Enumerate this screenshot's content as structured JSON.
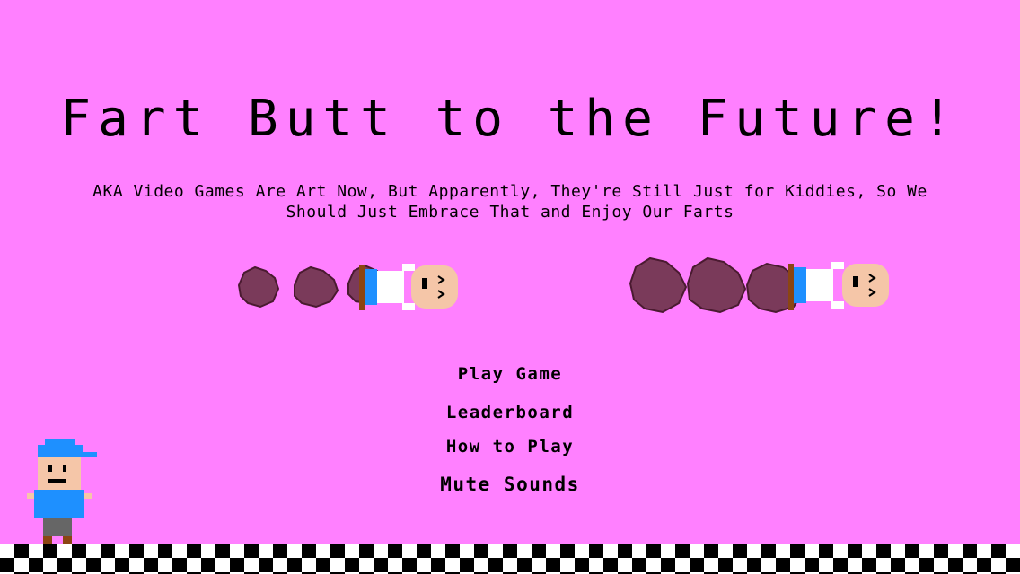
{
  "game": {
    "title": "Fart Butt to the Future!",
    "subtitle": "AKA Video Games Are Art Now, But Apparently, They're Still Just for Kiddies, So We Should Just Embrace That and Enjoy Our Farts"
  },
  "menu": {
    "play": "Play Game",
    "leaderboard": "Leaderboard",
    "how_to_play": "How to Play",
    "mute": "Mute Sounds"
  },
  "colors": {
    "background": "#ff80ff",
    "fart_cloud": "#7a3a5a",
    "character_shirt": "#1e90ff",
    "skin": "#f5c6a8"
  },
  "icons": [
    "fart-cloud-icon",
    "flying-kid-icon",
    "standing-kid-icon",
    "checkered-floor"
  ]
}
